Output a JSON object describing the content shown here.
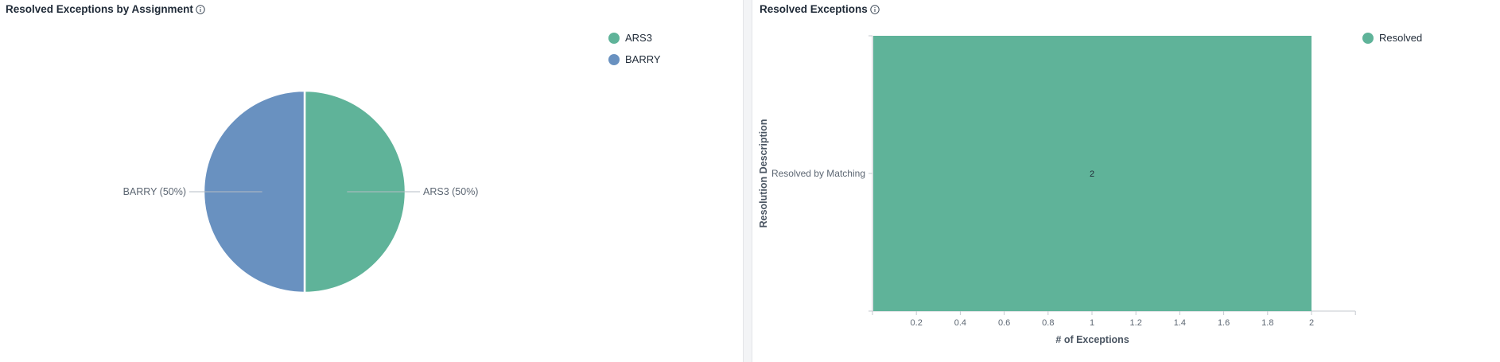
{
  "left_panel": {
    "title": "Resolved Exceptions by Assignment",
    "legend": [
      {
        "label": "ARS3",
        "color": "#5fb399"
      },
      {
        "label": "BARRY",
        "color": "#6991c0"
      }
    ]
  },
  "right_panel": {
    "title": "Resolved Exceptions",
    "legend": [
      {
        "label": "Resolved",
        "color": "#5fb399"
      }
    ]
  },
  "chart_data": [
    {
      "type": "pie",
      "title": "Resolved Exceptions by Assignment",
      "slices": [
        {
          "label": "ARS3",
          "value": 1,
          "percent_label": "ARS3 (50%)",
          "color": "#5fb399"
        },
        {
          "label": "BARRY",
          "value": 1,
          "percent_label": "BARRY (50%)",
          "color": "#6991c0"
        }
      ],
      "legend_position": "top-right"
    },
    {
      "type": "bar",
      "orientation": "horizontal",
      "title": "Resolved Exceptions",
      "categories": [
        "Resolved by Matching"
      ],
      "series": [
        {
          "name": "Resolved",
          "values": [
            2
          ],
          "color": "#5fb399"
        }
      ],
      "data_labels": [
        "2"
      ],
      "xlabel": "# of Exceptions",
      "ylabel": "Resolution Description",
      "xlim": [
        0,
        2.2
      ],
      "x_ticks": [
        0.2,
        0.4,
        0.6,
        0.8,
        1,
        1.2,
        1.4,
        1.6,
        1.8,
        2
      ],
      "x_tick_labels": [
        "0.2",
        "0.4",
        "0.6",
        "0.8",
        "1",
        "1.2",
        "1.4",
        "1.6",
        "1.8",
        "2"
      ],
      "legend_position": "top-right"
    }
  ]
}
